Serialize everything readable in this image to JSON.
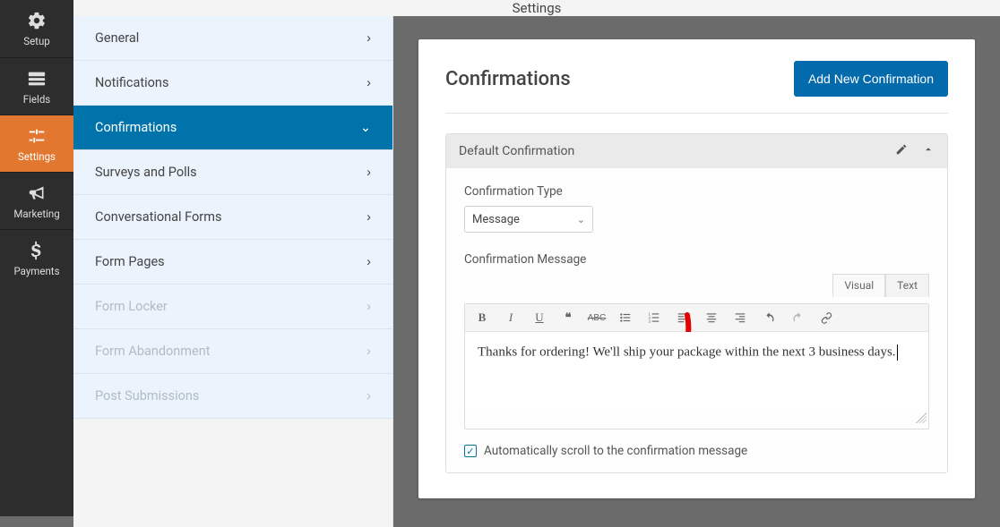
{
  "topbar": {
    "title": "Settings"
  },
  "rail": {
    "items": [
      {
        "label": "Setup"
      },
      {
        "label": "Fields"
      },
      {
        "label": "Settings"
      },
      {
        "label": "Marketing"
      },
      {
        "label": "Payments"
      }
    ]
  },
  "submenu": {
    "items": [
      {
        "label": "General"
      },
      {
        "label": "Notifications"
      },
      {
        "label": "Confirmations"
      },
      {
        "label": "Surveys and Polls"
      },
      {
        "label": "Conversational Forms"
      },
      {
        "label": "Form Pages"
      },
      {
        "label": "Form Locker"
      },
      {
        "label": "Form Abandonment"
      },
      {
        "label": "Post Submissions"
      }
    ]
  },
  "panel": {
    "title": "Confirmations",
    "add_button": "Add New Confirmation"
  },
  "confirmation": {
    "block_title": "Default Confirmation",
    "type_label": "Confirmation Type",
    "type_value": "Message",
    "message_label": "Confirmation Message",
    "message_value": "Thanks for ordering! We'll ship your package within the next 3 business days.",
    "checkbox_label": "Automatically scroll to the confirmation message",
    "checkbox_checked": true,
    "editor_tabs": {
      "visual": "Visual",
      "text": "Text"
    }
  }
}
